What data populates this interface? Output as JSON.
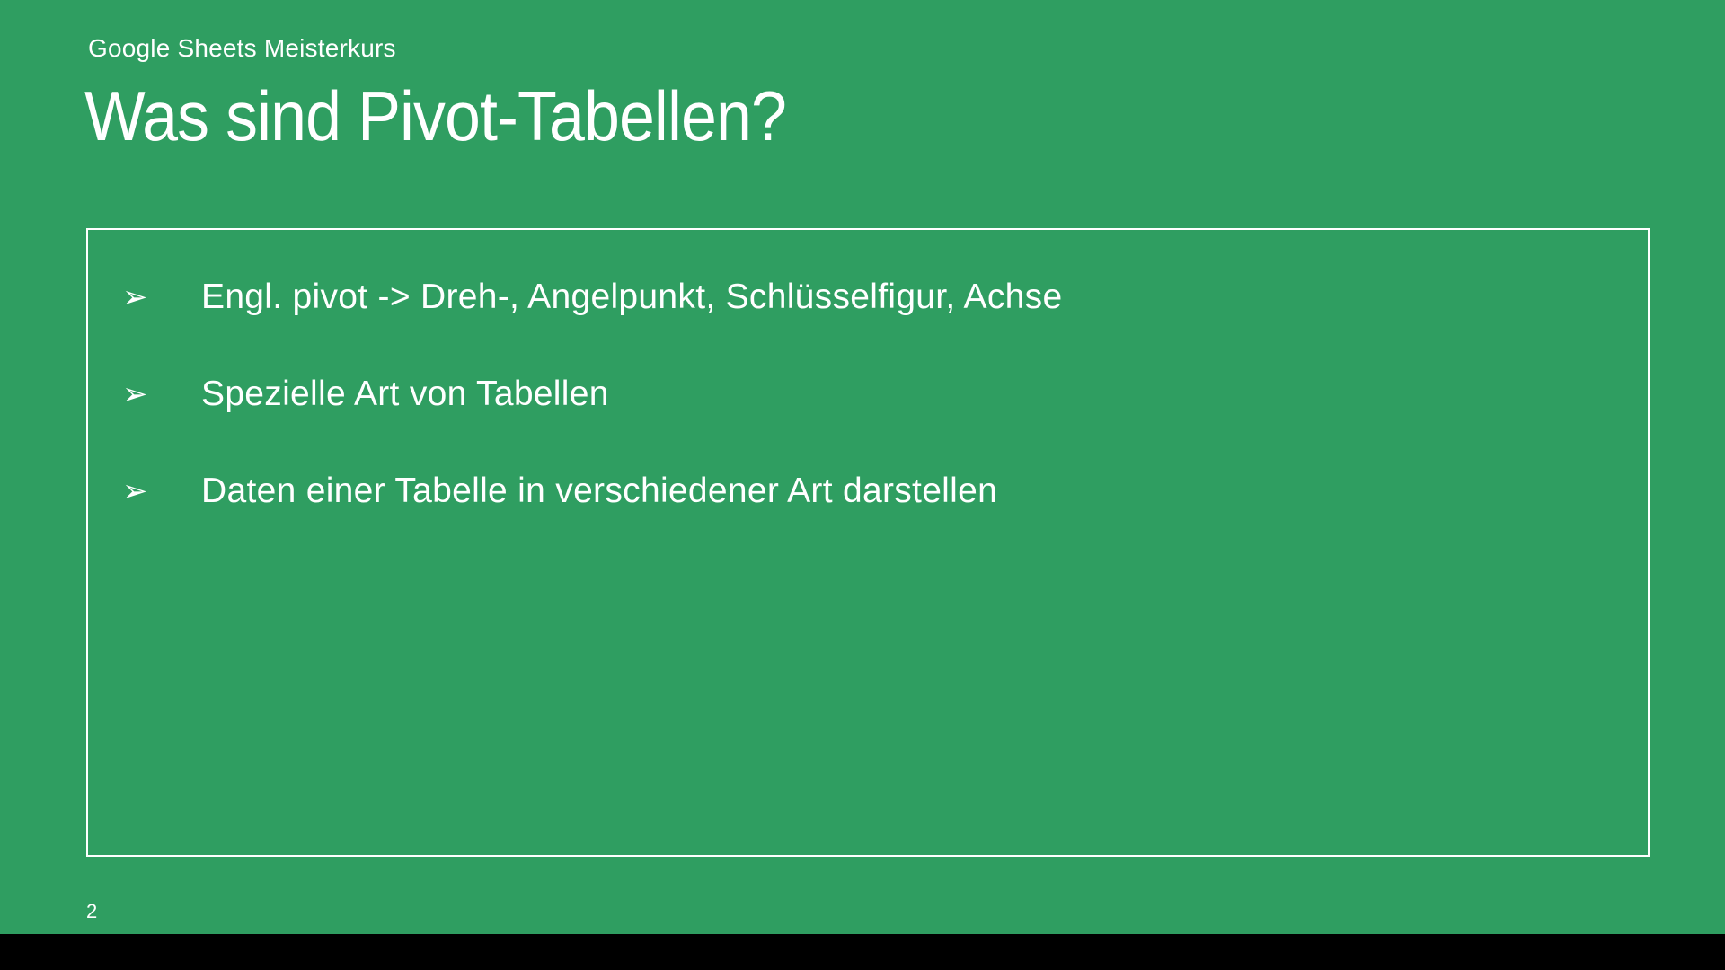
{
  "slide": {
    "subtitle": "Google Sheets Meisterkurs",
    "title": "Was sind Pivot-Tabellen?",
    "bullets": [
      "Engl. pivot -> Dreh-, Angelpunkt, Schlüsselfigur, Achse",
      "Spezielle Art von Tabellen",
      "Daten einer Tabelle in verschiedener Art darstellen"
    ],
    "bullet_glyph": "➢",
    "page_number": "2"
  },
  "colors": {
    "background": "#2f9e61",
    "text": "#ffffff",
    "bottom_bar": "#000000"
  }
}
